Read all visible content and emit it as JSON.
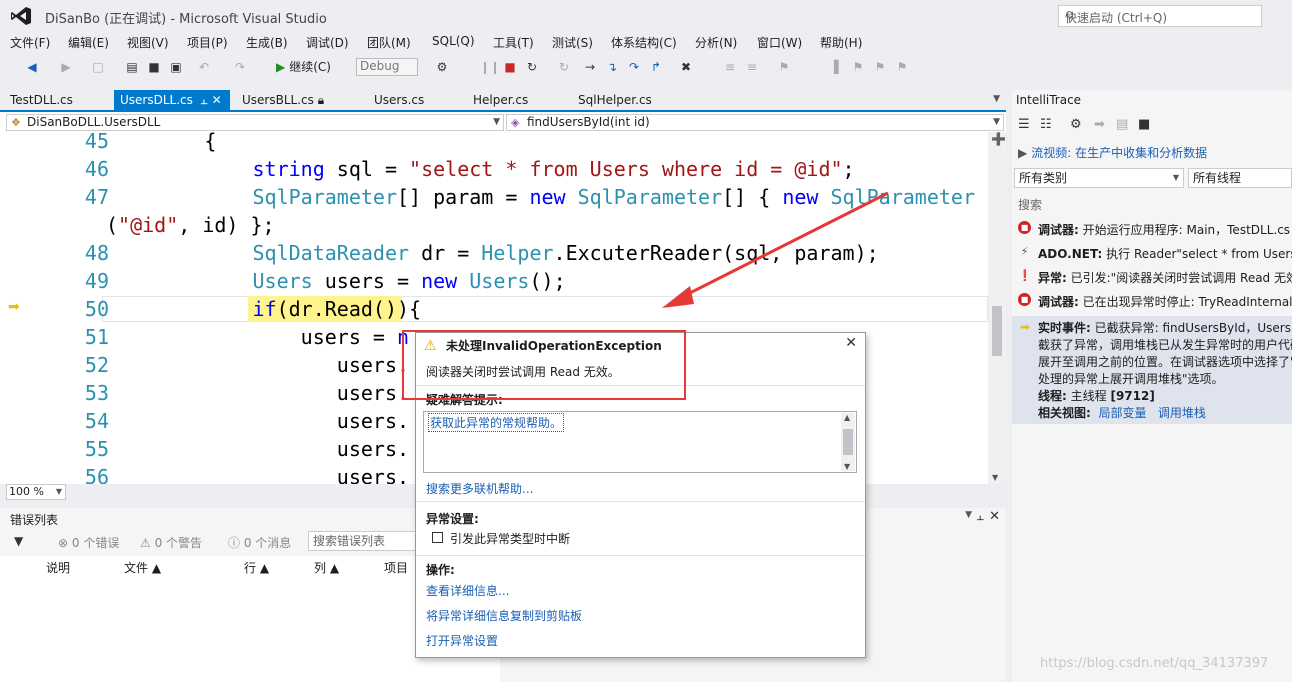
{
  "window": {
    "title": "DiSanBo (正在调试) - Microsoft Visual Studio",
    "quick_launch_placeholder": "快速启动 (Ctrl+Q)"
  },
  "menu": [
    "文件(F)",
    "编辑(E)",
    "视图(V)",
    "项目(P)",
    "生成(B)",
    "调试(D)",
    "团队(M)",
    "SQL(Q)",
    "工具(T)",
    "测试(S)",
    "体系结构(C)",
    "分析(N)",
    "窗口(W)",
    "帮助(H)"
  ],
  "toolbar": {
    "continue_label": "继续(C)",
    "config": "Debug"
  },
  "doc_tabs": [
    "TestDLL.cs",
    "UsersDLL.cs",
    "UsersBLL.cs",
    "Users.cs",
    "Helper.cs",
    "SqlHelper.cs"
  ],
  "nav": {
    "class": "DiSanBoDLL.UsersDLL",
    "method": "findUsersById(int id)"
  },
  "editor": {
    "zoom": "100 %",
    "line_numbers": [
      "45",
      "46",
      "47",
      "48",
      "49",
      "50",
      "51",
      "52",
      "53",
      "54",
      "55",
      "56"
    ]
  },
  "error_list": {
    "title": "错误列表",
    "errors": "0 个错误",
    "warnings": "0 个警告",
    "messages": "0 个消息",
    "search": "搜索错误列表",
    "columns": [
      "说明",
      "文件",
      "行",
      "列",
      "项目"
    ]
  },
  "exception": {
    "title": "未处理InvalidOperationException",
    "message": "阅读器关闭时尝试调用 Read 无效。",
    "tips_title": "疑难解答提示:",
    "tips_link": "获取此异常的常规帮助。",
    "more_help": "搜索更多联机帮助...",
    "settings_title": "异常设置:",
    "settings_checkbox": "引发此异常类型时中断",
    "actions_title": "操作:",
    "actions": [
      "查看详细信息...",
      "将异常详细信息复制到剪贴板",
      "打开异常设置"
    ]
  },
  "intellitrace": {
    "title": "IntelliTrace",
    "stream_link": "流视频: 在生产中收集和分析数据",
    "category": "所有类别",
    "thread": "所有线程",
    "search": "搜索",
    "events": [
      {
        "label": "调试器:",
        "text": "开始运行应用程序: Main，TestDLL.cs 行"
      },
      {
        "label": "ADO.NET:",
        "text": "执行 Reader\"select * from Users w"
      },
      {
        "label": "异常:",
        "text": "已引发:\"阅读器关闭时尝试调用 Read 无效"
      },
      {
        "label": "调试器:",
        "text": "已在出现异常时停止: TryReadInternal"
      }
    ],
    "live": {
      "label": "实时事件:",
      "text": "已截获异常: findUsersById，UsersD",
      "lines": [
        "截获了异常，调用堆栈已从发生异常时的用户代码",
        "展开至调用之前的位置。在调试器选项中选择了\"",
        "处理的异常上展开调用堆栈\"选项。"
      ],
      "thread_label": "线程:",
      "thread_value": "主线程 [9712]",
      "related_label": "相关视图:",
      "locals": "局部变量",
      "callstack": "调用堆栈"
    }
  },
  "watermark": "https://blog.csdn.net/qq_34137397"
}
